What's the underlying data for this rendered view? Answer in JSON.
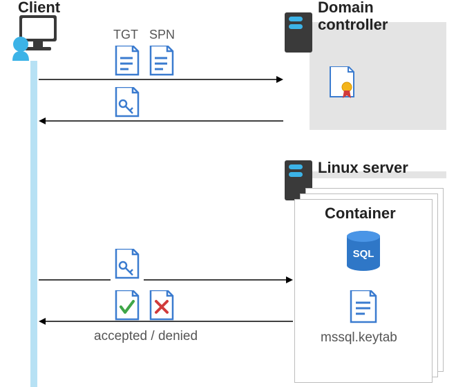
{
  "client": {
    "label": "Client"
  },
  "domain_controller": {
    "label": "Domain\ncontroller"
  },
  "linux_server": {
    "label": "Linux server"
  },
  "container": {
    "label": "Container",
    "keytab_label": "mssql.keytab",
    "db_label": "SQL"
  },
  "docs": {
    "tgt_label": "TGT",
    "spn_label": "SPN"
  },
  "result": {
    "label": "accepted / denied"
  }
}
